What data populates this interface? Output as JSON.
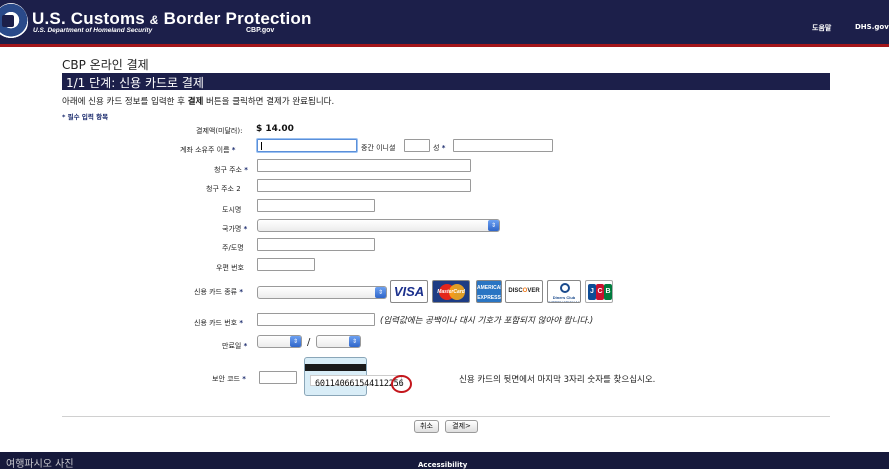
{
  "header": {
    "title_part1": "U.S. Customs",
    "title_amp": "&",
    "title_part2": "Border Protection",
    "subtitle": "U.S. Department of Homeland Security",
    "site": "CBP.gov",
    "nav_help": "도움말",
    "nav_dhs": "DHS.gov"
  },
  "page": {
    "title": "CBP 온라인 결제",
    "step_title": "1/1 단계: 신용 카드로 결제",
    "instructions_pre": "아래에 신용 카드 정보를 입력한 후 ",
    "instructions_bold": "결제",
    "instructions_post": " 버튼을 클릭하면 결제가 완료됩니다.",
    "required_note": "* 필수 입력 항목"
  },
  "form": {
    "amount_label": "결제액(미달러):",
    "amount_value": "$ 14.00",
    "account_name_label": "계좌 소유주  이름",
    "middle_initial_label": "중간 이니셜",
    "last_name_label": "성",
    "billing_address_label": "청구 주소",
    "billing_address2_label": "청구 주소 2",
    "city_label": "도시명",
    "country_label": "국가명",
    "state_label": "주/도명",
    "zip_label": "우편 번호",
    "card_type_label": "신용 카드 종류",
    "card_number_label": "신용 카드 번호",
    "card_number_hint": "(입력값에는 공백이나 대시 기호가 포함되지 않아야 합니다.)",
    "expiry_label": "만료일",
    "expiry_separator": "/",
    "cvv_label": "보안 코드",
    "cvv_card_number": "601140661544112",
    "cvv_code": "256",
    "cvv_hint": "신용 카드의 뒷면에서 마지막 3자리 숫자를 찾으십시오.",
    "required_mark": "*"
  },
  "card_logos": {
    "visa": "VISA",
    "mastercard": "MasterCard",
    "amex": "AMERICAN EXPRESS",
    "discover_pre": "DISC",
    "discover_o": "O",
    "discover_post": "VER",
    "diners": "Diners Club INTERNATIONAL",
    "jcb_j": "J",
    "jcb_c": "C",
    "jcb_b": "B"
  },
  "buttons": {
    "cancel": "취소",
    "next": "결제>"
  },
  "footer": {
    "accessibility": "Accessibility",
    "watermark": "여행파시오 사진"
  }
}
